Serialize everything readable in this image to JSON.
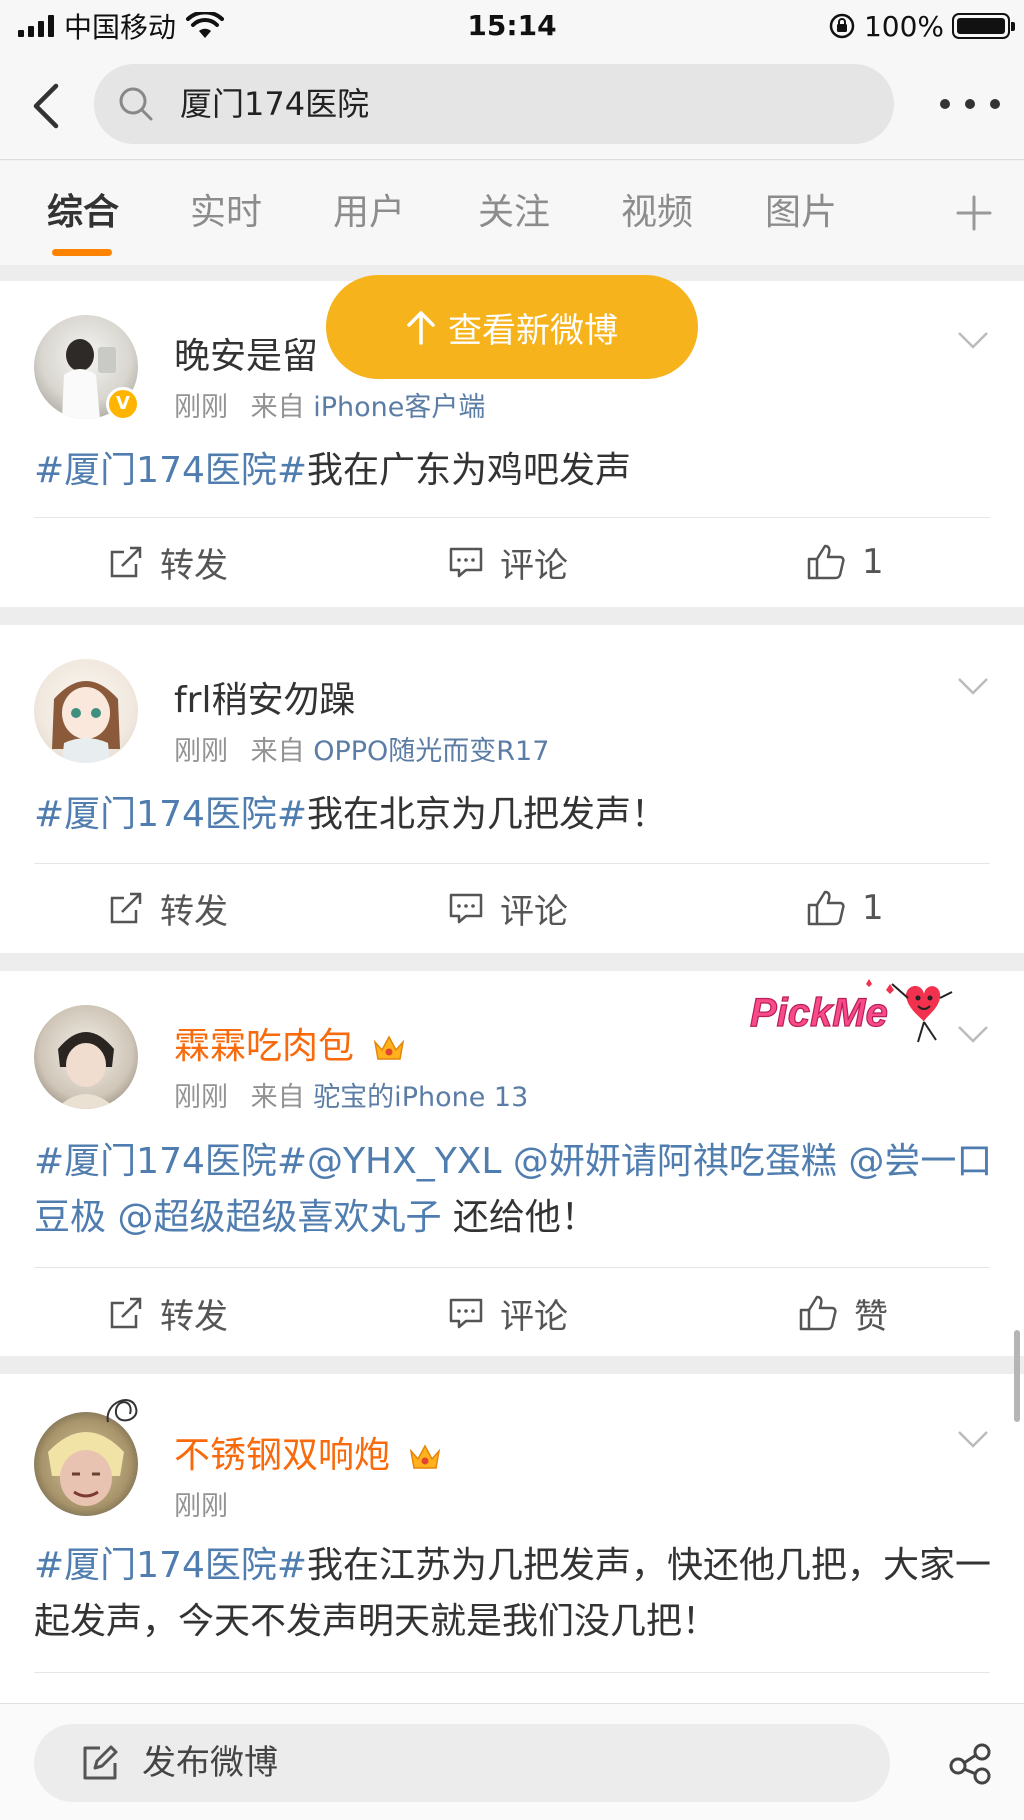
{
  "status": {
    "carrier": "中国移动",
    "time": "15:14",
    "battery": "100%",
    "battery_level": 1.0
  },
  "search": {
    "query": "厦门174医院"
  },
  "tabs": [
    {
      "label": "综合",
      "active": true
    },
    {
      "label": "实时"
    },
    {
      "label": "用户"
    },
    {
      "label": "关注"
    },
    {
      "label": "视频"
    },
    {
      "label": "图片"
    }
  ],
  "new_posts_label": "查看新微博",
  "posts": [
    {
      "username": "晚安是留",
      "verified": true,
      "time": "刚刚",
      "from_prefix": "来自",
      "source": "iPhone客户端",
      "topic": "#厦门174医院#",
      "text": "我在广东为鸡吧发声",
      "repost": "转发",
      "comment": "评论",
      "like": "1"
    },
    {
      "username": "frl稍安勿躁",
      "time": "刚刚",
      "from_prefix": "来自",
      "source": "OPPO随光而变R17",
      "topic": "#厦门174医院#",
      "text": "我在北京为几把发声！",
      "repost": "转发",
      "comment": "评论",
      "like": "1"
    },
    {
      "username": "霖霖吃肉包",
      "vip": true,
      "time": "刚刚",
      "from_prefix": "来自",
      "source": "驼宝的iPhone 13",
      "topic": "#厦门174医院#",
      "mentions": "@YHX_YXL @妍妍请阿祺吃蛋糕 @尝一口豆极 @超级超级喜欢丸子",
      "text": " 还给他！",
      "repost": "转发",
      "comment": "评论",
      "like": "赞",
      "sticker": "PickMe"
    },
    {
      "username": "不锈钢双响炮",
      "vip": true,
      "time": "刚刚",
      "topic": "#厦门174医院#",
      "text": "我在江苏为几把发声，快还他几把，大家一起发声，今天不发声明天就是我们没几把！"
    }
  ],
  "bottom": {
    "compose_label": "发布微博"
  },
  "colors": {
    "accent": "#ff8200",
    "pill": "#f6b31c",
    "link": "#507daf",
    "vip_name": "#f86a0c"
  }
}
